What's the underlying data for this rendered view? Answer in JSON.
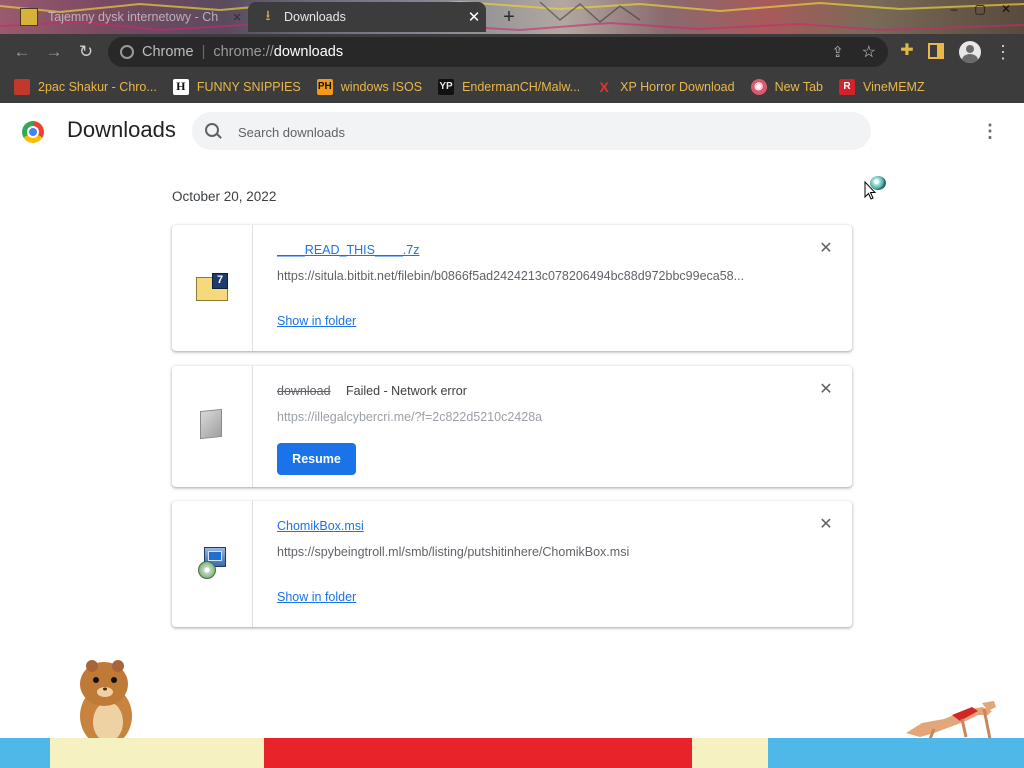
{
  "tabs": [
    {
      "title": "Tajemny dysk internetowy - Ch",
      "close_icon": "×"
    },
    {
      "title": "Downloads",
      "close_icon": "✕"
    }
  ],
  "new_tab_icon": "+",
  "window_controls": {
    "minimize": "–",
    "maximize": "▢",
    "close": "✕"
  },
  "omnibox": {
    "site_label": "Chrome",
    "separator": "|",
    "url_prefix": "chrome://",
    "url_path": "downloads"
  },
  "bookmarks": [
    {
      "label": "2pac Shakur - Chro...",
      "icon": "icon-2pac",
      "icon_text": "",
      "icon_bg": "#c0392b",
      "icon_color": "#ffffff"
    },
    {
      "label": "FUNNY SNIPPIES",
      "icon": "H",
      "icon_text": "H",
      "icon_bg": "#ffffff",
      "icon_color": "#111111"
    },
    {
      "label": "windows ISOS",
      "icon": "PH",
      "icon_text": "PH",
      "icon_bg": "#f29a18",
      "icon_color": "#111111"
    },
    {
      "label": "EndermanCH/Malw...",
      "icon": "YP",
      "icon_text": "YP",
      "icon_bg": "#111111",
      "icon_color": "#e8e8e8"
    },
    {
      "label": "XP Horror Download",
      "icon": "X",
      "icon_text": "X",
      "icon_bg": "transparent",
      "icon_color": "#e8312a"
    },
    {
      "label": "New Tab",
      "icon": "globe-icon",
      "icon_text": "",
      "icon_bg": "#d95a6e",
      "icon_color": "#ffffff"
    },
    {
      "label": "VineMEMZ",
      "icon": "R",
      "icon_text": "R",
      "icon_bg": "#d2232a",
      "icon_color": "#ffffff"
    }
  ],
  "page": {
    "title": "Downloads",
    "search_placeholder": "Search downloads",
    "more_menu_icon": "⋮"
  },
  "date_group": "October 20, 2022",
  "downloads": [
    {
      "file_name": "____READ_THIS____.7z",
      "url": "https://situla.bitbit.net/filebin/b0866f5ad2424213c078206494bc88d972bbc99eca58...",
      "action_label": "Show in folder",
      "close_icon": "✕",
      "file_icon": "7z-archive-icon"
    },
    {
      "file_name": "download",
      "status": "Failed - Network error",
      "url": "https://illegalcybercri.me/?f=2c822d5210c2428a",
      "action_label": "Resume",
      "close_icon": "✕",
      "file_icon": "generic-file-icon"
    },
    {
      "file_name": "ChomikBox.msi",
      "url": "https://spybeingtroll.ml/smb/listing/putshitinhere/ChomikBox.msi",
      "action_label": "Show in folder",
      "close_icon": "✕",
      "file_icon": "msi-installer-icon"
    }
  ],
  "colors": {
    "chrome_dark": "#3c3c3c",
    "bookmark_text": "#e8b84a",
    "link_blue": "#1a73e8",
    "resume_blue": "#1a73e8"
  }
}
